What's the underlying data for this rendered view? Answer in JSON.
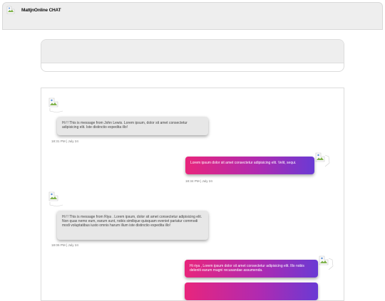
{
  "header": {
    "brand": "MattjnOnline CHAT",
    "logo_icon": "broken-image-icon"
  },
  "messages": [
    {
      "direction": "in",
      "text": "Hi !! This is message from John Lewis. Lorem ipsum, dolor sit amet consectetur adipisicing elit. Iste distinctio expedita illo!",
      "time": "18:31 PM | July 24"
    },
    {
      "direction": "out",
      "text": "Lorem ipsum dolor sit amet consectetur adipisicing elit. Velit, sequi.",
      "time": "18:34 PM | July 24"
    },
    {
      "direction": "in",
      "text": "Hi !! This is message from Riya . Lorem ipsum, dolor sit amet consectetur adipisicing elit. Non quas nemo eum, earum sunt, nobis similique quisquam eveniet pariatur commodi modi voluptatibus iusto omnis harum illum iste distinctio expedita illo!",
      "time": "18:06 PM | July 24"
    },
    {
      "direction": "out",
      "text": "Hi riya , Lorem ipsum dolor sit amet consectetur adipisicing elit. Illo nobis deleniti earum magni recusandae assumenda.",
      "time": ""
    },
    {
      "direction": "out",
      "text": "",
      "time": ""
    }
  ],
  "colors": {
    "gradient_start": "#e8257c",
    "gradient_mid": "#b12ab0",
    "gradient_end": "#6a3ad4",
    "incoming_bubble": "#e7e7e7",
    "header_bg": "#eeeeee"
  }
}
